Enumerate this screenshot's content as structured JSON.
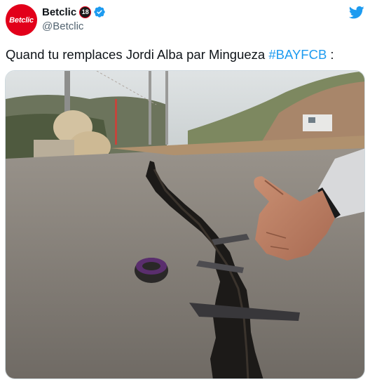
{
  "account": {
    "avatar_text": "Betclic",
    "display_name": "Betclic",
    "age_badge": "18",
    "handle": "@Betclic",
    "brand_color": "#e2001a"
  },
  "icons": {
    "verified": "verified-badge-icon",
    "logo": "twitter-bird-icon"
  },
  "tweet": {
    "text_prefix": "Quand tu remplaces Jordi Alba par Mingueza ",
    "hashtag": "#BAYFCB",
    "text_suffix": " :",
    "hashtag_color": "#1d9bf0"
  },
  "media": {
    "description_icon": "road-crack-photo"
  }
}
